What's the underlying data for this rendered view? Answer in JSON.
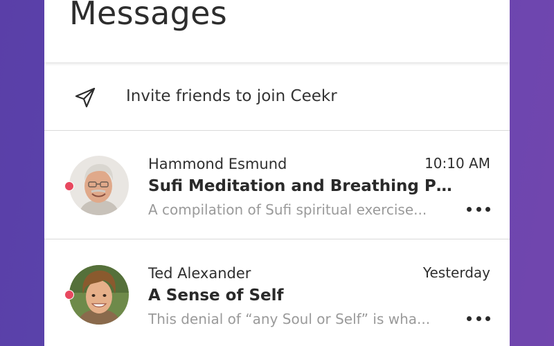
{
  "header": {
    "title": "Messages"
  },
  "invite": {
    "label": "Invite friends to join Ceekr",
    "icon": "send-icon"
  },
  "messages": [
    {
      "sender": "Hammond Esmund",
      "time": "10:10 AM",
      "subject": "Sufi Meditation and Breathing Pra...",
      "preview": "A compilation of Sufi spiritual exercise...",
      "unread": true,
      "avatar": "older-man-glasses-avatar"
    },
    {
      "sender": "Ted Alexander",
      "time": "Yesterday",
      "subject": "A Sense of Self",
      "preview": "This denial of “any Soul or Self” is wha...",
      "unread": true,
      "avatar": "young-man-curly-hair-avatar"
    }
  ],
  "colors": {
    "background": "#5b46ad",
    "unread_dot": "#e8485f",
    "divider": "#d9d9d9",
    "preview_text": "#9a9a9a"
  }
}
